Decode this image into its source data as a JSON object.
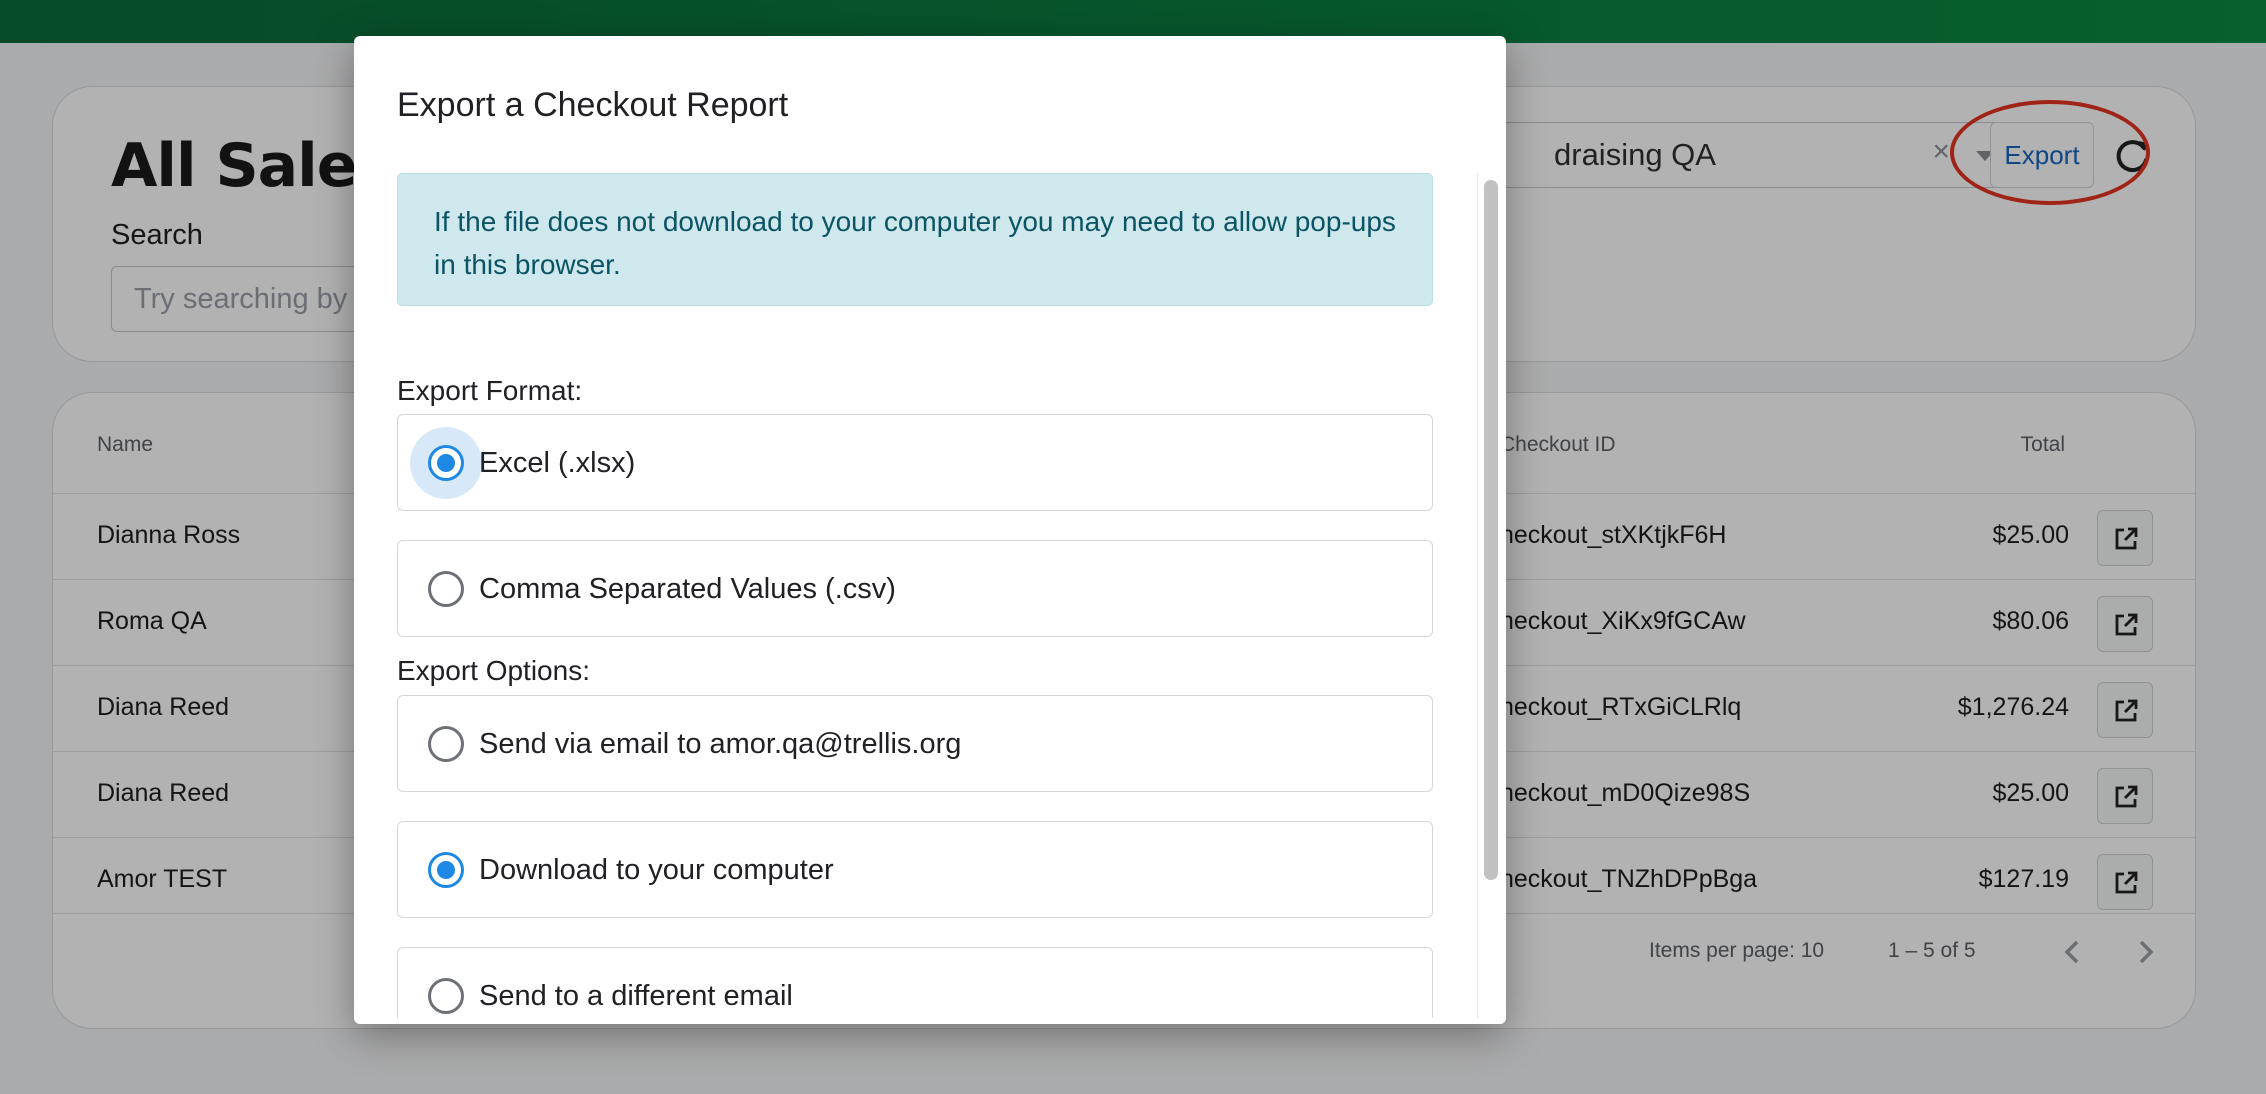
{
  "page": {
    "title": "All Sales",
    "search_label": "Search",
    "search_placeholder": "Try searching by",
    "campaign_select_value": "draising QA",
    "clear_symbol": "×",
    "export_label": "Export"
  },
  "table": {
    "headers": {
      "name": "Name",
      "checkout_id": "Checkout ID",
      "total": "Total"
    },
    "rows": [
      {
        "name": "Dianna Ross",
        "checkout_id": "heckout_stXKtjkF6H",
        "total": "$25.00"
      },
      {
        "name": "Roma QA",
        "checkout_id": "heckout_XiKx9fGCAw",
        "total": "$80.06"
      },
      {
        "name": "Diana Reed",
        "checkout_id": "heckout_RTxGiCLRlq",
        "total": "$1,276.24"
      },
      {
        "name": "Diana Reed",
        "checkout_id": "heckout_mD0Qize98S",
        "total": "$25.00"
      },
      {
        "name": "Amor TEST",
        "checkout_id": "heckout_TNZhDPpBga",
        "total": "$127.19"
      }
    ],
    "footer": {
      "items_per_page": "Items per page: 10",
      "range": "1 – 5 of 5"
    }
  },
  "modal": {
    "title": "Export a Checkout Report",
    "info_text": "If the file does not download to your computer you may need to allow pop-ups in this browser.",
    "format_label": "Export Format:",
    "formats": [
      {
        "label": "Excel (.xlsx)",
        "selected": true
      },
      {
        "label": "Comma Separated Values (.csv)",
        "selected": false
      }
    ],
    "options_label": "Export Options:",
    "options": [
      {
        "label": "Send via email to amor.qa@trellis.org",
        "selected": false
      },
      {
        "label": "Download to your computer",
        "selected": true
      },
      {
        "label": "Send to a different email",
        "selected": false
      }
    ]
  },
  "colors": {
    "accent": "#1e88e5",
    "topbar": "#0b6b3a",
    "annotation": "#e53321",
    "info_bg": "#cfe8ed",
    "export_text": "#1565c0"
  },
  "icons": {
    "refresh": "refresh-icon",
    "open": "open-in-new-icon",
    "clear": "close-icon",
    "caret": "caret-down-icon",
    "prev": "chevron-left-icon",
    "next": "chevron-right-icon"
  }
}
